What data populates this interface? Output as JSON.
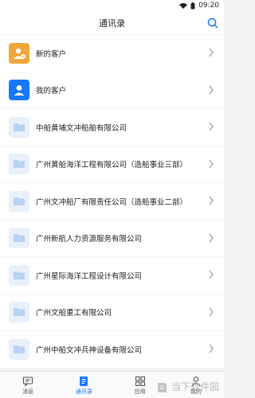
{
  "status": {
    "time": "09:20"
  },
  "header": {
    "title": "通讯录"
  },
  "list": [
    {
      "label": "新的客户",
      "icon": "new-customer-icon",
      "color": "#f0a73a"
    },
    {
      "label": "我的客户",
      "icon": "my-customer-icon",
      "color": "#1677ff"
    },
    {
      "label": "中船黄埔文冲船舶有限公司",
      "icon": "folder-icon"
    },
    {
      "label": "广州黄船海洋工程有限公司（造船事业三部）",
      "icon": "folder-icon"
    },
    {
      "label": "广州文冲船厂有限责任公司（造船事业二部）",
      "icon": "folder-icon"
    },
    {
      "label": "广州新航人力资源服务有限公司",
      "icon": "folder-icon"
    },
    {
      "label": "广州星际海洋工程设计有限公司",
      "icon": "folder-icon"
    },
    {
      "label": "广州文船重工有限公司",
      "icon": "folder-icon"
    },
    {
      "label": "广州中船文冲兵神设备有限公司",
      "icon": "folder-icon"
    }
  ],
  "tabs": [
    {
      "label": "消息",
      "icon": "message-icon"
    },
    {
      "label": "通讯录",
      "icon": "contacts-icon",
      "active": true
    },
    {
      "label": "应用",
      "icon": "apps-icon"
    },
    {
      "label": "我的",
      "icon": "profile-icon"
    }
  ],
  "watermark": {
    "text": "当下软件园"
  },
  "colors": {
    "accent": "#1677ff",
    "folder": "#cfe0f7",
    "folder_bg": "#e8f0fb"
  }
}
